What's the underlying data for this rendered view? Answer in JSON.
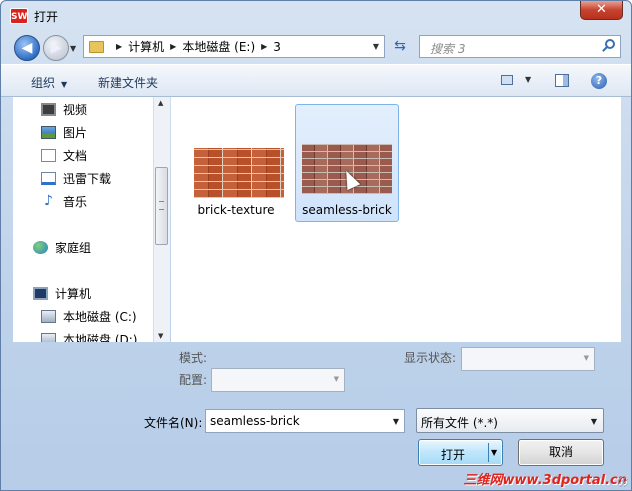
{
  "window": {
    "title": "打开",
    "app_icon": "SW",
    "close_glyph": "✕"
  },
  "nav": {
    "back_glyph": "◀",
    "forward_glyph": "▶",
    "breadcrumbs": [
      "计算机",
      "本地磁盘 (E:)",
      "3"
    ],
    "search_placeholder": "搜索 3"
  },
  "toolbar": {
    "organize": "组织",
    "new_folder": "新建文件夹",
    "help": "?"
  },
  "sidebar": {
    "items": [
      {
        "label": "视频",
        "icon": "video-icon"
      },
      {
        "label": "图片",
        "icon": "picture-icon"
      },
      {
        "label": "文档",
        "icon": "document-icon"
      },
      {
        "label": "迅雷下载",
        "icon": "download-icon"
      },
      {
        "label": "音乐",
        "icon": "music-icon"
      },
      {
        "label": "家庭组",
        "icon": "homegroup-icon"
      },
      {
        "label": "计算机",
        "icon": "computer-icon"
      },
      {
        "label": "本地磁盘 (C:)",
        "icon": "drive-icon"
      },
      {
        "label": "本地磁盘 (D:)",
        "icon": "drive-icon"
      }
    ]
  },
  "files": [
    {
      "name": "brick-texture",
      "selected": false
    },
    {
      "name": "seamless-brick",
      "selected": true
    }
  ],
  "options": {
    "mode_label": "模式:",
    "config_label": "配置:",
    "display_state_label": "显示状态:"
  },
  "footer": {
    "filename_label": "文件名(N):",
    "filename_value": "seamless-brick",
    "filetype_value": "所有文件 (*.*)",
    "open_label": "打开",
    "cancel_label": "取消"
  },
  "watermark": "三维网www.3dportal.cn",
  "colors": {
    "accent": "#3c7fb1",
    "selection": "#cfe3fb",
    "watermark": "#e0241b"
  }
}
